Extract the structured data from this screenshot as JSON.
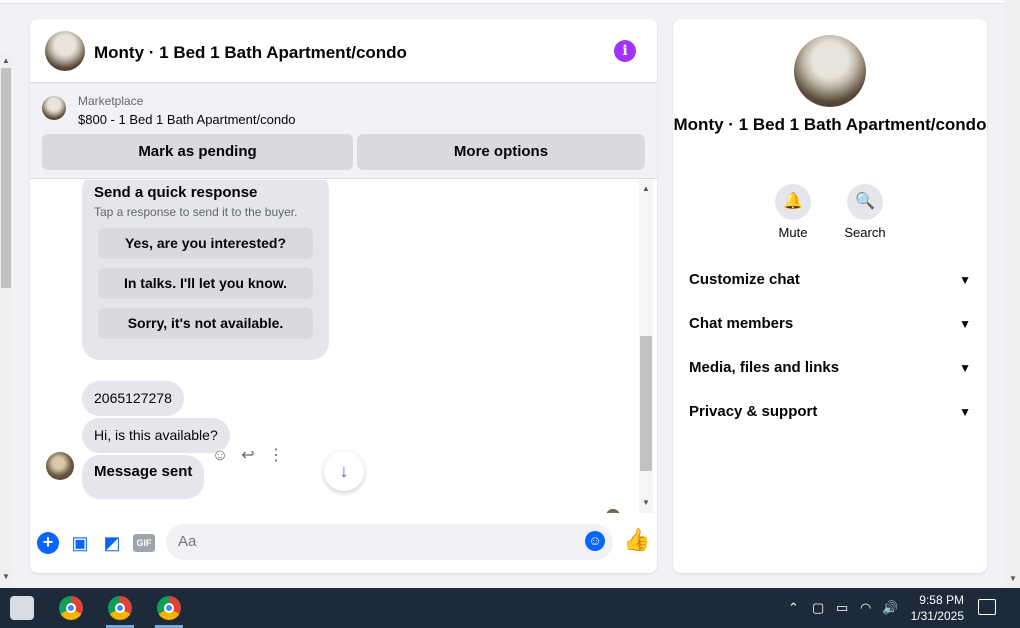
{
  "chat": {
    "title": "Monty · 1 Bed 1 Bath Apartment/condo",
    "marketplace_label": "Marketplace",
    "listing": "$800 - 1 Bed 1 Bath Apartment/condo",
    "mark_pending": "Mark as pending",
    "more_options": "More options"
  },
  "quick_response": {
    "title": "Send a quick response",
    "subtitle": "Tap a response to send it to the buyer.",
    "options": [
      "Yes, are you interested?",
      "In talks. I'll let you know.",
      "Sorry, it's not available."
    ]
  },
  "messages": [
    "2065127278",
    "Hi, is this available?",
    "Message sent"
  ],
  "composer": {
    "placeholder": "Aa",
    "gif_label": "GIF"
  },
  "info_panel": {
    "name": "Monty · 1 Bed 1 Bath Apartment/condo",
    "mute": "Mute",
    "search": "Search",
    "sections": [
      "Customize chat",
      "Chat members",
      "Media, files and links",
      "Privacy & support"
    ]
  },
  "taskbar": {
    "time": "9:58 PM",
    "date": "1/31/2025"
  },
  "colors": {
    "accent": "#0866ff",
    "info_purple": "#a033ff",
    "taskbar": "#1c2a3a"
  }
}
